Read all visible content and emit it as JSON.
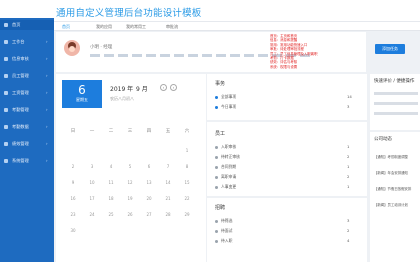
{
  "app": {
    "title": "通用自定义管理后台功能设计模板"
  },
  "nav": {
    "tabs": [
      "首页",
      "我的应用",
      "我的常用工",
      "审批流"
    ]
  },
  "sidebar": {
    "items": [
      {
        "label": "首页",
        "active": true
      },
      {
        "label": "工作台",
        "active": false
      },
      {
        "label": "信息审核",
        "active": false
      },
      {
        "label": "员工管理",
        "active": false
      },
      {
        "label": "工资管理",
        "active": false
      },
      {
        "label": "考勤管理",
        "active": false
      },
      {
        "label": "考勤数据",
        "active": false
      },
      {
        "label": "绩效管理",
        "active": false
      },
      {
        "label": "系统管理",
        "active": false
      }
    ]
  },
  "profile": {
    "name": "小明 · 经理",
    "button": "添加任务"
  },
  "notes": [
    "首页：主页和首页",
    "信息：消息和提醒",
    "常用：常用功能快速入口",
    "审批：待处理审批流程",
    "员工：员工信息管理及入职离职",
    "考勤：打卡数据",
    "绩效：评估与考核",
    "系统：权限与设置"
  ],
  "calendar": {
    "day": "6",
    "day_label": "星期五",
    "year": "2019 年",
    "month": "9 月",
    "sub": "农历八月初八",
    "weekdays": [
      "日",
      "一",
      "二",
      "三",
      "四",
      "五",
      "六"
    ],
    "weeks": [
      [
        "",
        "",
        "",
        "",
        "",
        "",
        "1"
      ],
      [
        "2",
        "3",
        "4",
        "5",
        "6",
        "7",
        "8"
      ],
      [
        "9",
        "10",
        "11",
        "12",
        "13",
        "14",
        "15"
      ],
      [
        "16",
        "17",
        "18",
        "19",
        "20",
        "21",
        "22"
      ],
      [
        "23",
        "24",
        "25",
        "26",
        "27",
        "28",
        "29"
      ],
      [
        "30",
        "",
        "",
        "",
        "",
        "",
        ""
      ]
    ]
  },
  "tasks": {
    "title": "事务",
    "items": [
      {
        "label": "全部事项",
        "count": "14"
      },
      {
        "label": "今日事项",
        "count": "3"
      }
    ]
  },
  "staff": {
    "title": "员工",
    "items": [
      {
        "label": "入职审核",
        "count": "1"
      },
      {
        "label": "待转正审核",
        "count": "2"
      },
      {
        "label": "合同到期",
        "count": "1"
      },
      {
        "label": "离职申请",
        "count": "2"
      },
      {
        "label": "人事变更",
        "count": "1"
      }
    ]
  },
  "recruit": {
    "title": "招聘",
    "items": [
      {
        "label": "待筛选",
        "count": "3"
      },
      {
        "label": "待面试",
        "count": "2"
      },
      {
        "label": "待入职",
        "count": "4"
      }
    ]
  },
  "quick": {
    "title": "快速评价 / 便捷操作",
    "rows": [
      [
        "",
        "",
        ""
      ],
      [
        "",
        "",
        ""
      ]
    ]
  },
  "news": {
    "title": "公司动态",
    "items": [
      "【通知】考勤制度调整",
      "【新闻】年会安排通知",
      "【通知】节假日放假安排",
      "【新闻】员工培训计划"
    ]
  }
}
